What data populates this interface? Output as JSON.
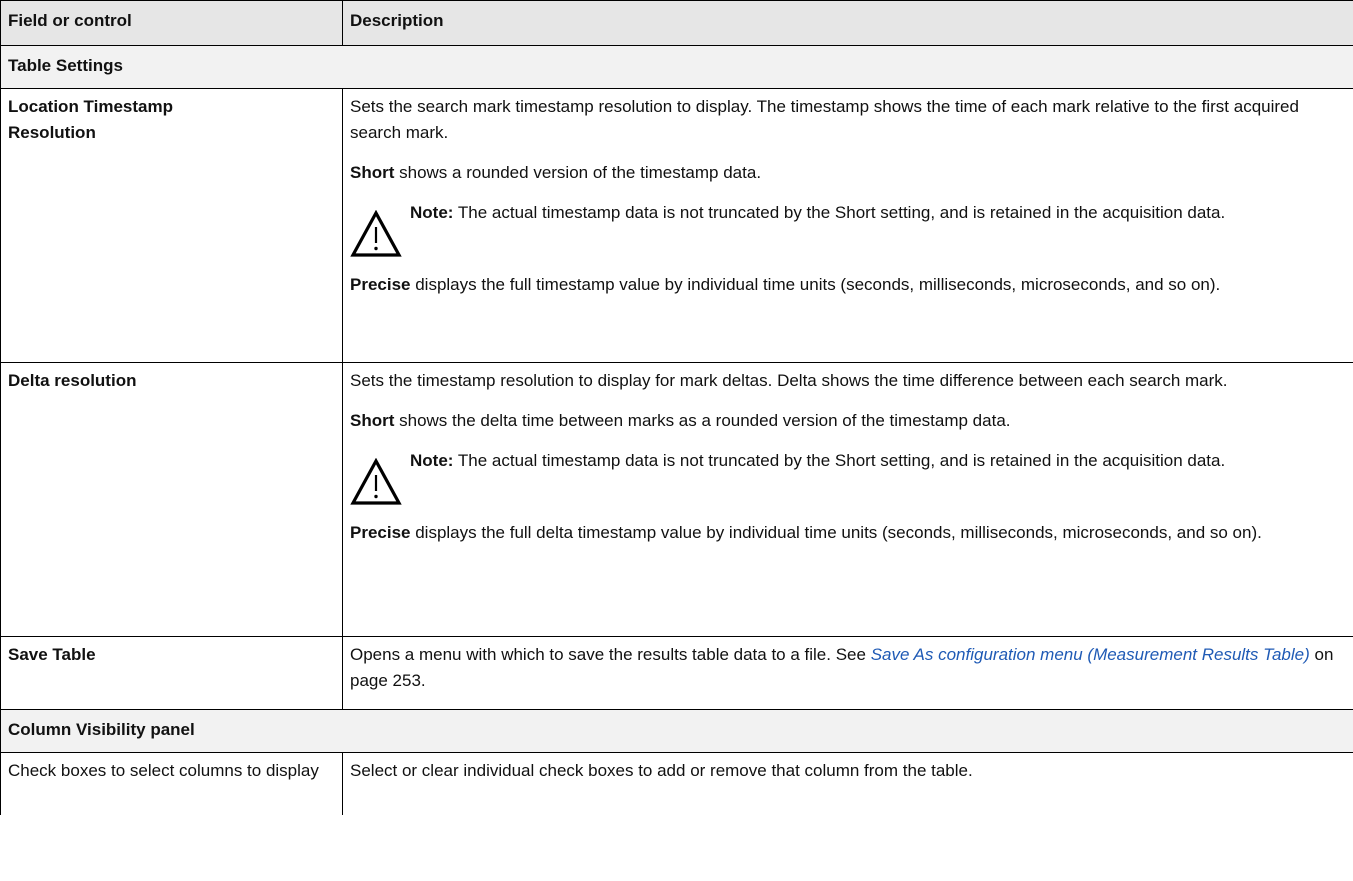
{
  "header": {
    "col1": "Field or control",
    "col2": "Description"
  },
  "sections": {
    "table_settings": "Table Settings",
    "column_visibility": "Column Visibility panel"
  },
  "rows": {
    "location": {
      "field_line1": "Location Timestamp",
      "field_line2": "Resolution",
      "p1": "Sets the search mark timestamp resolution to display. The timestamp shows the time of each mark relative to the first acquired search mark.",
      "short_kw": "Short",
      "short_text": " shows a rounded version of the timestamp data.",
      "note_label": "Note:",
      "note_text": " The actual timestamp data is not truncated by the Short setting, and is retained in the acquisition data.",
      "precise_kw": "Precise",
      "precise_text": " displays the full timestamp value by individual time units (seconds, milliseconds, microseconds, and so on)."
    },
    "delta": {
      "field": "Delta resolution",
      "p1": "Sets the timestamp resolution to display for mark deltas. Delta shows the time difference between each search mark.",
      "short_kw": "Short",
      "short_text": " shows the delta time between marks as a rounded version of the timestamp data.",
      "note_label": "Note:",
      "note_text": " The actual timestamp data is not truncated by the Short setting, and is retained in the acquisition data.",
      "precise_kw": "Precise",
      "precise_text": " displays the full delta timestamp value by individual time units (seconds, milliseconds, microseconds, and so on)."
    },
    "save": {
      "field": "Save Table",
      "text_before": "Opens a menu with which to save the results table data to a file. See ",
      "link": "Save As configuration menu (Measurement Results Table)",
      "text_after": " on page 253."
    },
    "checkboxes": {
      "field": "Check boxes to select columns to display",
      "desc": "Select or clear individual check boxes to add or remove that column from the table."
    }
  },
  "icons": {
    "warning": "warning-triangle-icon"
  },
  "colors": {
    "link": "#1f5ab5",
    "header_bg": "#e6e6e6",
    "section_bg": "#f2f2f2"
  }
}
